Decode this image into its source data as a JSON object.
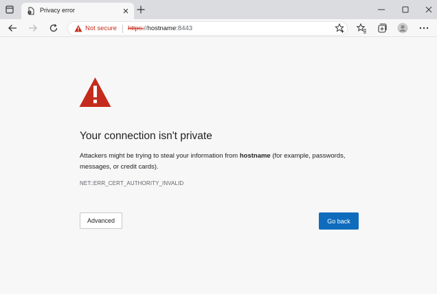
{
  "tab": {
    "title": "Privacy error",
    "favicon": "page-warning-icon"
  },
  "toolbar": {
    "security_label": "Not secure",
    "url_scheme": "https:",
    "url_slashes": "//",
    "url_host": "hostname",
    "url_port": ":8443"
  },
  "content": {
    "heading": "Your connection isn't private",
    "desc_part1": "Attackers might be trying to steal your information from ",
    "desc_host": "hostname",
    "desc_part2": " (for example, passwords, messages, or credit cards).",
    "error_code": "NET::ERR_CERT_AUTHORITY_INVALID",
    "advanced_label": "Advanced",
    "go_back_label": "Go back"
  },
  "colors": {
    "warning_red": "#c42b1c",
    "primary_blue": "#0f6cbd",
    "page_bg": "#f7f7f7"
  }
}
